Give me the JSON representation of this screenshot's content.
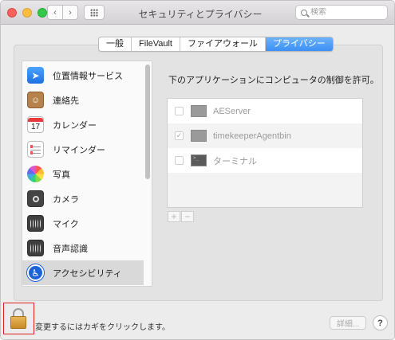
{
  "window": {
    "title": "セキュリティとプライバシー",
    "nav_back": "‹",
    "nav_forward": "›",
    "search_placeholder": "検索"
  },
  "tabs": [
    {
      "label": "一般",
      "active": false
    },
    {
      "label": "FileVault",
      "active": false
    },
    {
      "label": "ファイアウォール",
      "active": false
    },
    {
      "label": "プライバシー",
      "active": true
    }
  ],
  "sidebar": {
    "items": [
      {
        "label": "位置情報サービス",
        "icon": "location-arrow-icon",
        "glyph": "➤"
      },
      {
        "label": "連絡先",
        "icon": "contacts-book-icon",
        "glyph": "☺"
      },
      {
        "label": "カレンダー",
        "icon": "calendar-icon",
        "glyph": "17"
      },
      {
        "label": "リマインダー",
        "icon": "reminders-icon",
        "glyph": ""
      },
      {
        "label": "写真",
        "icon": "photos-icon",
        "glyph": ""
      },
      {
        "label": "カメラ",
        "icon": "camera-icon",
        "glyph": ""
      },
      {
        "label": "マイク",
        "icon": "microphone-icon",
        "glyph": ""
      },
      {
        "label": "音声認識",
        "icon": "speech-recognition-icon",
        "glyph": ""
      },
      {
        "label": "アクセシビリティ",
        "icon": "accessibility-icon",
        "glyph": "♿",
        "selected": true
      }
    ]
  },
  "main": {
    "instruction": "下のアプリケーションにコンピュータの制御を許可。",
    "apps": [
      {
        "name": "AEServer",
        "checked": false,
        "check_glyph": ""
      },
      {
        "name": "timekeeperAgentbin",
        "checked": true,
        "check_glyph": "✓"
      },
      {
        "name": "ターミナル",
        "checked": false,
        "check_glyph": ""
      }
    ],
    "add_label": "+",
    "remove_label": "−"
  },
  "footer": {
    "lock_text": "変更するにはカギをクリックします。",
    "advanced_label": "詳細...",
    "help_label": "?"
  },
  "colors": {
    "accent": "#3c8ff5",
    "highlight_box": "#e02020"
  }
}
